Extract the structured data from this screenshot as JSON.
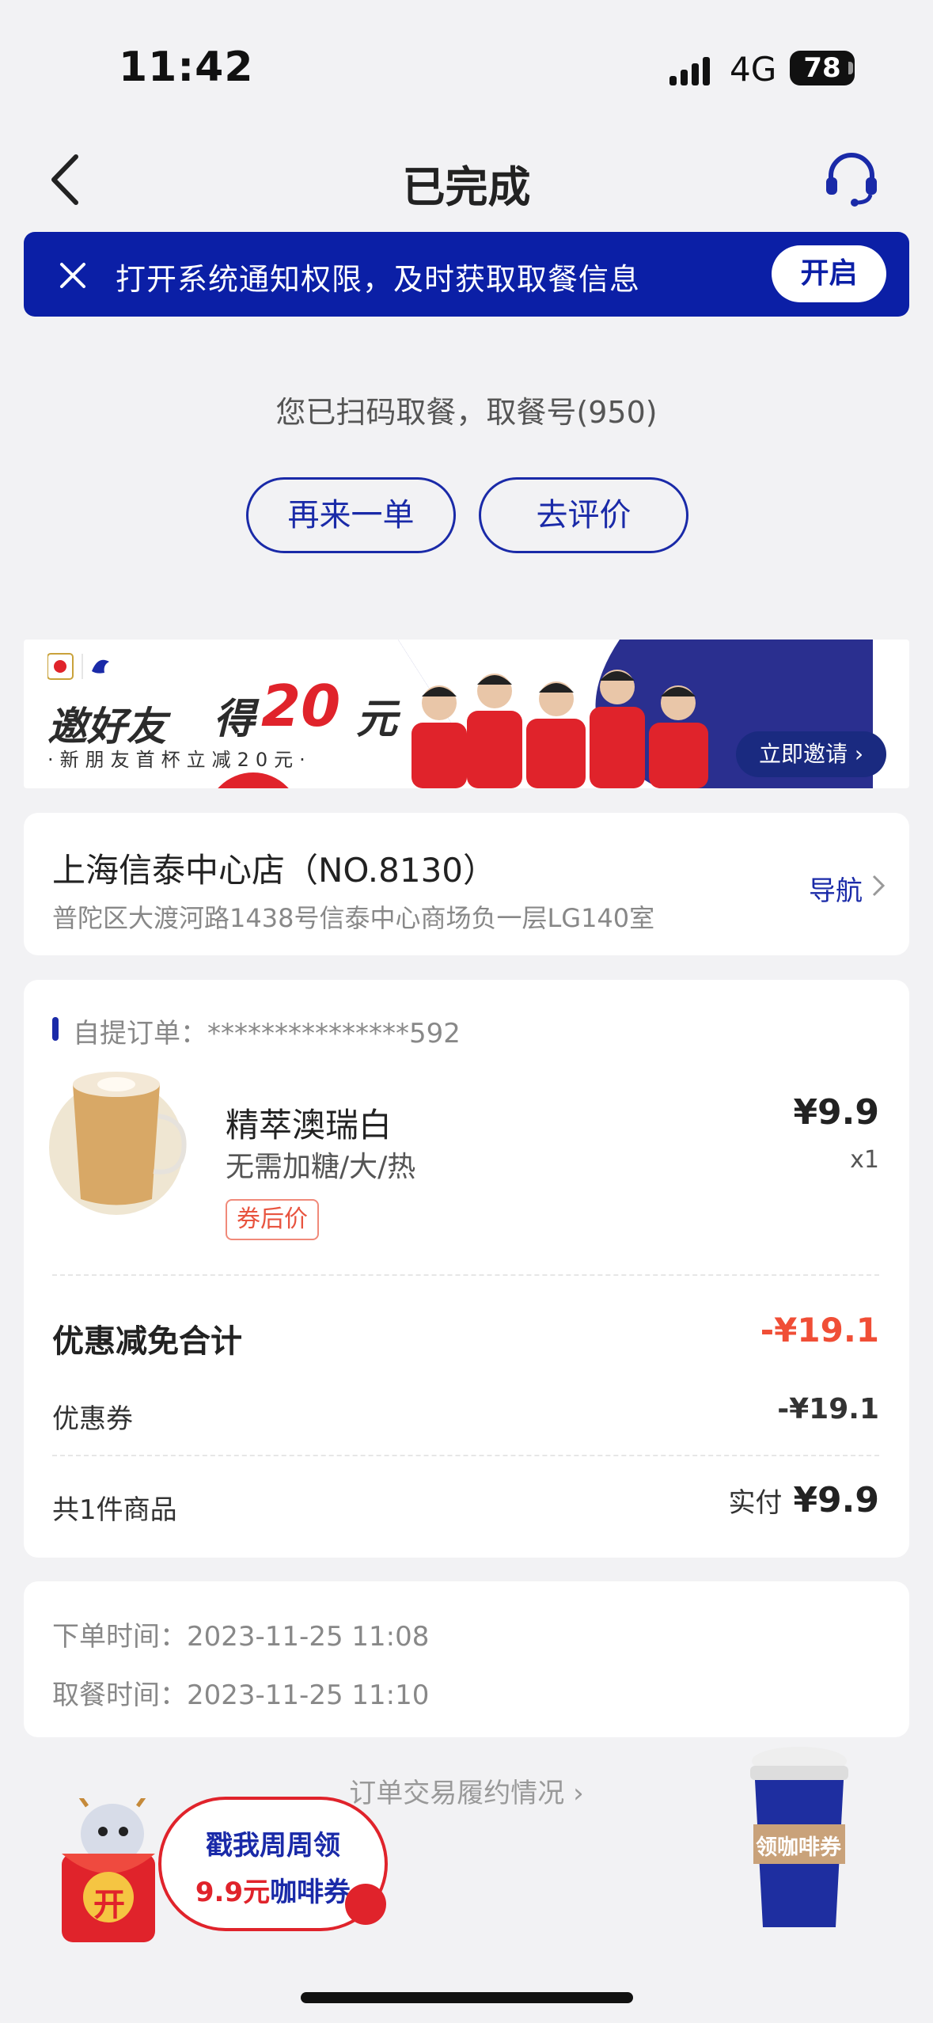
{
  "status_bar": {
    "time": "11:42",
    "network": "4G",
    "battery": "78"
  },
  "nav": {
    "title": "已完成",
    "back_icon": "back-arrow-icon",
    "support_icon": "headset-icon"
  },
  "notice": {
    "text": "打开系统通知权限，及时获取取餐信息",
    "button": "开启"
  },
  "pickup": {
    "message": "您已扫码取餐，取餐号(950)",
    "reorder_button": "再来一单",
    "review_button": "去评价"
  },
  "ad": {
    "headline_1": "邀好友",
    "headline_2": "得",
    "headline_amount": "20",
    "headline_unit": "元",
    "subline": "·新朋友首杯立减20元·",
    "cta": "立即邀请"
  },
  "store": {
    "name": "上海信泰中心店（NO.8130）",
    "address": "普陀区大渡河路1438号信泰中心商场负一层LG140室",
    "nav_label": "导航"
  },
  "order": {
    "label": "自提订单：",
    "number": "***************592",
    "item": {
      "name": "精萃澳瑞白",
      "spec": "无需加糖/大/热",
      "tag": "券后价",
      "price": "¥9.9",
      "qty": "x1"
    },
    "discount_label": "优惠减免合计",
    "discount_value": "-¥19.1",
    "coupon_label": "优惠券",
    "coupon_value": "-¥19.1",
    "count_label": "共1件商品",
    "paid_label": "实付",
    "paid_value": "¥9.9"
  },
  "times": {
    "order_label": "下单时间：",
    "order_time": "2023-11-25 11:08",
    "pickup_label": "取餐时间：",
    "pickup_time": "2023-11-25 11:10"
  },
  "fulfilment_link": "订单交易履约情况",
  "promo": {
    "line1": "戳我周周领",
    "amount": "9.9元",
    "suffix": "咖啡券",
    "envelope_char": "开",
    "cup_label": "领咖啡券"
  },
  "colors": {
    "brand_blue": "#0b1fa6",
    "discount_red": "#f04e36",
    "background": "#f2f2f4"
  }
}
